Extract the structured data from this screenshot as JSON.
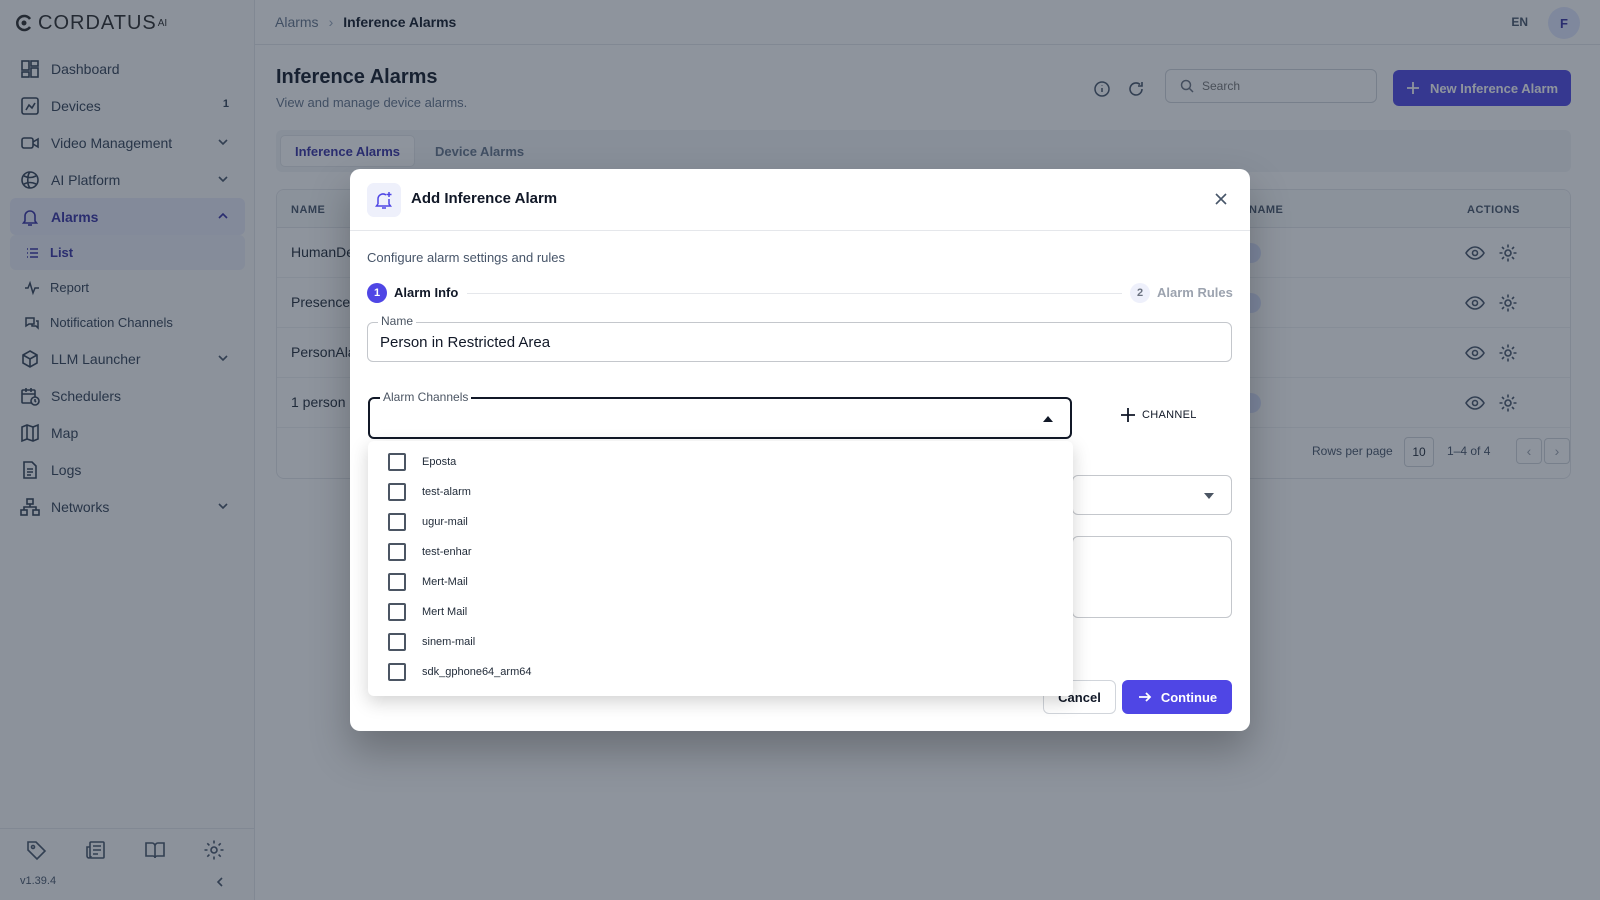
{
  "app": {
    "brand": "CORDATUS",
    "brand_sup": "AI",
    "version": "v1.39.4"
  },
  "sidebar": {
    "items": [
      {
        "label": "Dashboard",
        "icon": "dashboard-icon"
      },
      {
        "label": "Devices",
        "icon": "devices-icon",
        "badge": "1"
      },
      {
        "label": "Video Management",
        "icon": "video-icon"
      },
      {
        "label": "AI Platform",
        "icon": "ai-platform-icon"
      },
      {
        "label": "Alarms",
        "icon": "bell-icon"
      },
      {
        "label": "LLM Launcher",
        "icon": "box-icon"
      },
      {
        "label": "Schedulers",
        "icon": "calendar-clock-icon"
      },
      {
        "label": "Map",
        "icon": "map-icon"
      },
      {
        "label": "Logs",
        "icon": "file-text-icon"
      },
      {
        "label": "Networks",
        "icon": "network-icon"
      }
    ],
    "alarm_sub": [
      {
        "label": "List",
        "icon": "list-icon"
      },
      {
        "label": "Report",
        "icon": "activity-icon"
      },
      {
        "label": "Notification Channels",
        "icon": "message-channels-icon"
      }
    ]
  },
  "topbar": {
    "breadcrumb": [
      "Alarms",
      "Inference Alarms"
    ],
    "lang": "EN",
    "avatar": "F"
  },
  "page": {
    "title": "Inference Alarms",
    "subtitle": "View and manage device alarms.",
    "search_placeholder": "Search",
    "new_button": "New Inference Alarm",
    "tabs": [
      "Inference Alarms",
      "Device Alarms"
    ]
  },
  "table": {
    "headers": {
      "name": "NAME",
      "app_name": "N NAME",
      "actions": "ACTIONS"
    },
    "rows": [
      "HumanDe",
      "Presence",
      "PersonAla",
      "1 person"
    ],
    "rows_per_page_label": "Rows per page",
    "rows_per_page": "10",
    "range": "1–4 of 4"
  },
  "modal": {
    "title": "Add Inference Alarm",
    "description": "Configure alarm settings and rules",
    "steps": [
      {
        "num": "1",
        "label": "Alarm Info"
      },
      {
        "num": "2",
        "label": "Alarm Rules"
      }
    ],
    "name_label": "Name",
    "name_value": "Person in Restricted Area",
    "channels_label": "Alarm Channels",
    "add_channel": "CHANNEL",
    "cancel": "Cancel",
    "continue": "Continue"
  },
  "dropdown": {
    "options": [
      "Eposta",
      "test-alarm",
      "ugur-mail",
      "test-enhar",
      "Mert-Mail",
      "Mert Mail",
      "sinem-mail",
      "sdk_gphone64_arm64"
    ]
  },
  "colors": {
    "accent": "#4f46e5",
    "overlay": "#1e293b"
  }
}
